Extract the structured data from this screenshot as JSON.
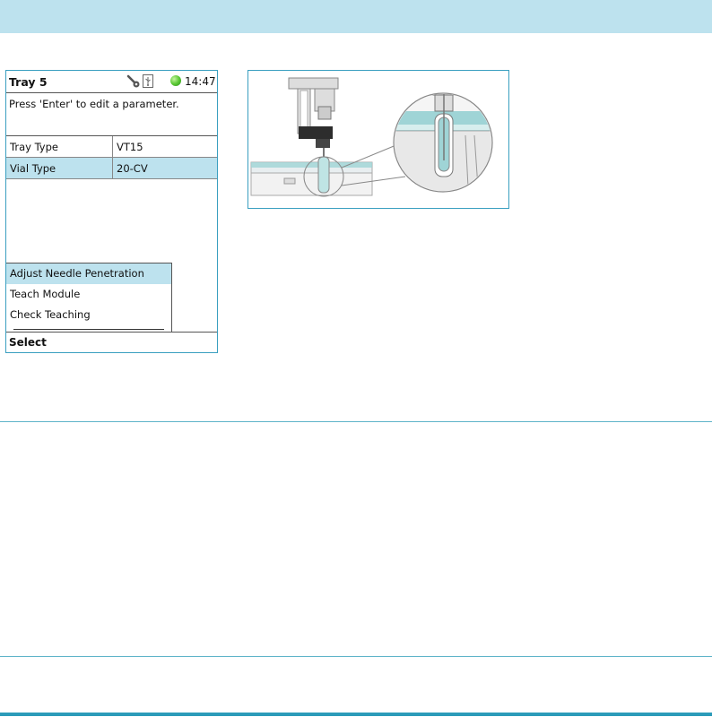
{
  "screen": {
    "title": "Tray 5",
    "time": "14:47",
    "instruction": "Press 'Enter' to edit a parameter.",
    "parameters": [
      {
        "name": "Tray Type",
        "value": "VT15",
        "selected": false
      },
      {
        "name": "Vial Type",
        "value": "20-CV",
        "selected": true
      }
    ],
    "menu_items": [
      {
        "label": "Adjust Needle Penetration",
        "selected": true
      },
      {
        "label": "Teach Module",
        "selected": false
      },
      {
        "label": "Check Teaching",
        "selected": false
      }
    ],
    "softkey": "Select",
    "icons": [
      "wrench-key-icon",
      "usb-icon",
      "status-ok-icon"
    ],
    "colors": {
      "highlight": "#bde2ee",
      "status_ok": "#5bc935",
      "frame": "#3a9fc0"
    }
  }
}
